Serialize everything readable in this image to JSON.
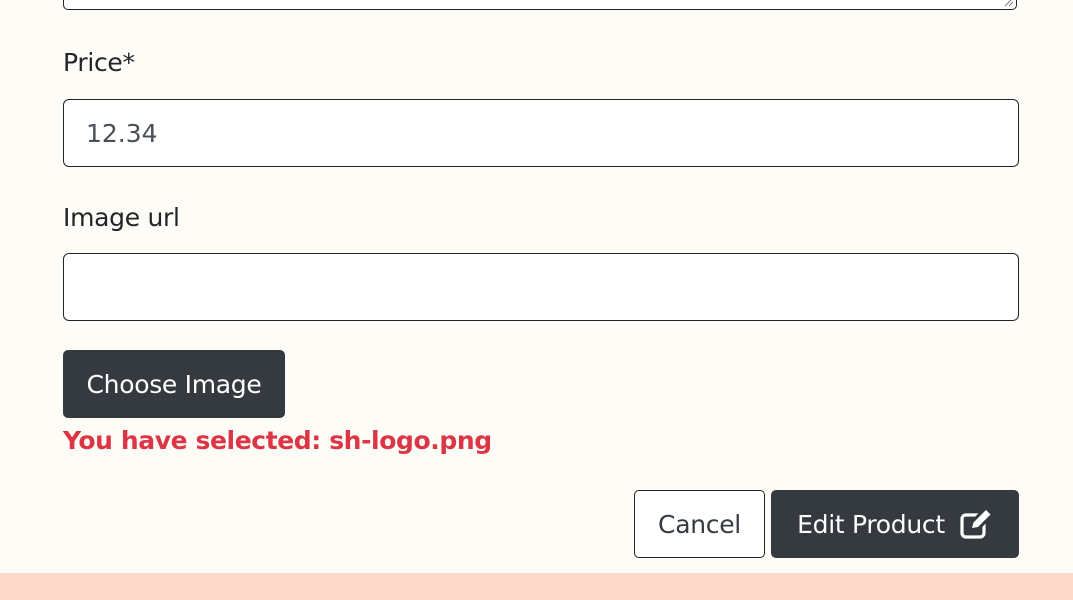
{
  "form": {
    "price": {
      "label": "Price*",
      "value": "12.34"
    },
    "image_url": {
      "label": "Image url",
      "value": ""
    },
    "choose_image_label": "Choose Image",
    "selected_message": "You have selected: sh-logo.png",
    "cancel_label": "Cancel",
    "submit_label": "Edit Product",
    "submit_icon": "edit-icon"
  },
  "colors": {
    "page_background": "#fefcf7",
    "dark_button": "#343a40",
    "error_text": "#dc3545",
    "footer_band": "#fdd9cc"
  }
}
